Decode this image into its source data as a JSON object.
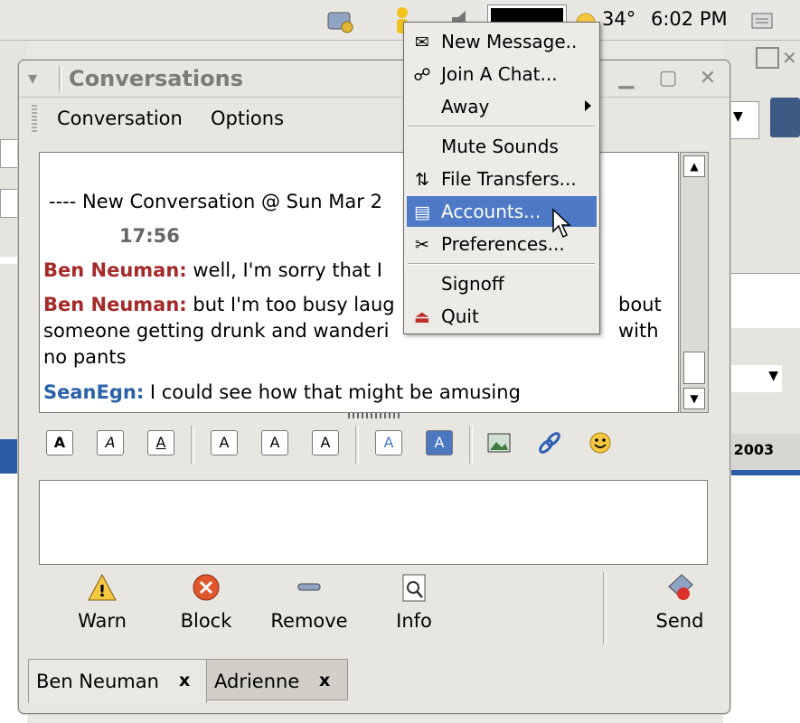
{
  "panel": {
    "temperature": "34°",
    "time": "6:02 PM"
  },
  "window": {
    "title": "Conversations",
    "menu": [
      "Conversation",
      "Options"
    ]
  },
  "chat": {
    "header": "---- New Conversation @ Sun Mar  2",
    "time": "17:56",
    "messages": [
      {
        "sender": "Ben Neuman:",
        "text": " well, I'm sorry that I"
      },
      {
        "sender": "Ben Neuman:",
        "text": " but I'm too busy laug",
        "text_end": "bout",
        "line2": "someone getting drunk and wanderi",
        "line2_end": "with",
        "line3": "no pants"
      },
      {
        "sender": "SeanEgn:",
        "text": " I could see how that might be amusing"
      }
    ]
  },
  "format_toolbar": {
    "buttons": [
      "A",
      "A",
      "A",
      "A",
      "A",
      "A",
      "A",
      "A"
    ]
  },
  "actions": {
    "warn": "Warn",
    "block": "Block",
    "remove": "Remove",
    "info": "Info",
    "send": "Send"
  },
  "tabs": [
    {
      "label": "Ben Neuman",
      "close": "x"
    },
    {
      "label": "Adrienne",
      "close": "x"
    }
  ],
  "popup_menu": {
    "items": [
      {
        "label": "New Message..",
        "icon": "new-message-icon"
      },
      {
        "label": "Join A Chat...",
        "icon": "join-chat-icon"
      },
      {
        "label": "Away",
        "icon": ""
      },
      {
        "label": "Mute Sounds",
        "icon": ""
      },
      {
        "label": "File Transfers...",
        "icon": "file-transfers-icon"
      },
      {
        "label": "Accounts...",
        "icon": "accounts-icon"
      },
      {
        "label": "Preferences...",
        "icon": "preferences-icon"
      },
      {
        "label": "Signoff",
        "icon": ""
      },
      {
        "label": "Quit",
        "icon": "quit-icon"
      }
    ],
    "active_index": 5
  },
  "background": {
    "date_fragment": ", 2003"
  }
}
